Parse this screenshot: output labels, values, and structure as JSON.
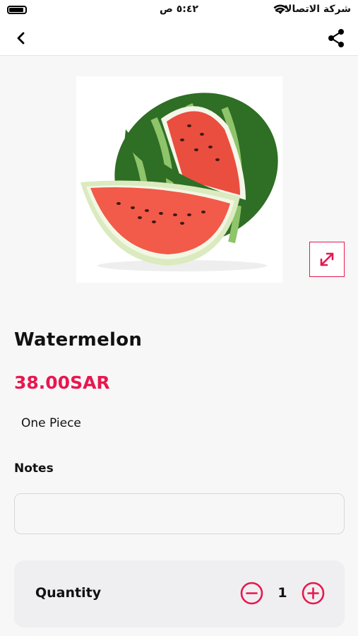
{
  "status_bar": {
    "carrier": "شركة الاتصالات",
    "time": "٥:٤٢ ص"
  },
  "nav": {
    "back_icon": "chevron-left-icon",
    "share_icon": "share-icon"
  },
  "product": {
    "image": "watermelon",
    "expand_icon": "expand-arrows-icon",
    "name": "Watermelon",
    "price": "38.00SAR",
    "unit": "One Piece"
  },
  "notes": {
    "label": "Notes",
    "value": "",
    "placeholder": ""
  },
  "quantity": {
    "label": "Quantity",
    "value": "1",
    "minus_icon": "minus-circle-icon",
    "plus_icon": "plus-circle-icon"
  },
  "colors": {
    "accent": "#e8174f",
    "background": "#f7f7f8",
    "card": "#efeff1"
  }
}
